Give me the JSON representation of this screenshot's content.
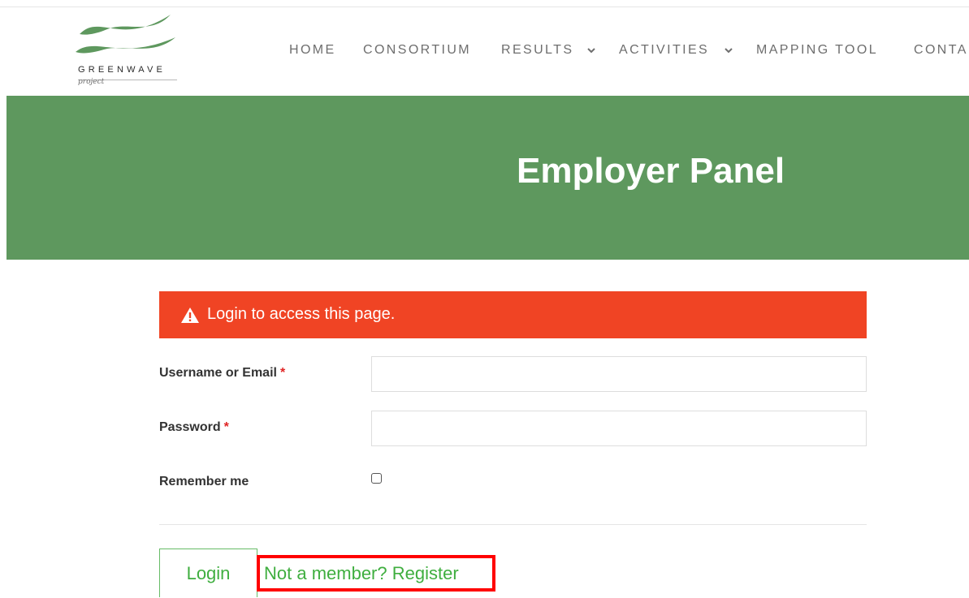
{
  "brand": {
    "logo_word": "GREENWAVE",
    "logo_sub": "project",
    "wave_color": "#5e985e"
  },
  "nav": {
    "items": [
      {
        "label": "HOME",
        "has_dropdown": false
      },
      {
        "label": "CONSORTIUM",
        "has_dropdown": false
      },
      {
        "label": "RESULTS",
        "has_dropdown": true
      },
      {
        "label": "ACTIVITIES",
        "has_dropdown": true
      },
      {
        "label": "MAPPING TOOL",
        "has_dropdown": false
      },
      {
        "label": "CONTA",
        "has_dropdown": false
      }
    ],
    "dropdown_icon": "chevron-down-icon"
  },
  "hero": {
    "title": "Employer Panel",
    "background": "#5e985e"
  },
  "alert": {
    "icon": "warning-triangle-icon",
    "message": "Login to access this page.",
    "background": "#f04424"
  },
  "form": {
    "username": {
      "label": "Username or Email",
      "required_mark": "*",
      "value": "",
      "placeholder": ""
    },
    "password": {
      "label": "Password",
      "required_mark": "*",
      "value": "",
      "placeholder": ""
    },
    "remember": {
      "label": "Remember me",
      "checked": false
    },
    "login_label": "Login",
    "register_label": "Not a member? Register"
  },
  "colors": {
    "accent_green": "#3fae3f",
    "required_red": "#e02424",
    "highlight_red": "#ff0000"
  }
}
